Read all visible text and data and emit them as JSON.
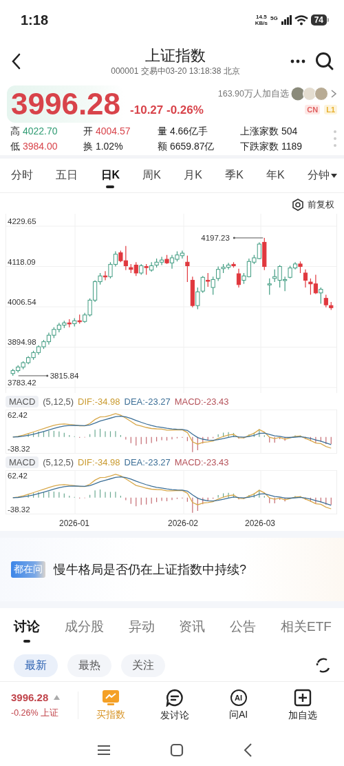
{
  "status_bar": {
    "time": "1:18",
    "net_speed": "14.5",
    "net_unit": "KB/s",
    "network": "5G",
    "battery": "74"
  },
  "header": {
    "title": "上证指数",
    "subtitle": "000001 交易中03-20 13:18:38 北京"
  },
  "quote": {
    "price": "3996.28",
    "change": "-10.27",
    "change_pct": "-0.26%",
    "followers": "163.90万人加自选",
    "badges": [
      "CN",
      "L1"
    ],
    "stats": [
      {
        "label": "高",
        "value": "4022.70",
        "color": "#2e9b72"
      },
      {
        "label": "开",
        "value": "4004.57",
        "color": "#d8434a"
      },
      {
        "label": "量",
        "value": "4.66亿手",
        "color": "#222222"
      },
      {
        "label": "上涨家数",
        "value": "504",
        "color": "#222222"
      },
      {
        "label": "低",
        "value": "3984.00",
        "color": "#d8434a"
      },
      {
        "label": "换",
        "value": "1.02%",
        "color": "#222222"
      },
      {
        "label": "额",
        "value": "6659.87亿",
        "color": "#222222"
      },
      {
        "label": "下跌家数",
        "value": "1189",
        "color": "#222222"
      }
    ]
  },
  "period_tabs": [
    {
      "label": "分时",
      "selected": false,
      "has_menu": false
    },
    {
      "label": "五日",
      "selected": false,
      "has_menu": false
    },
    {
      "label": "日K",
      "selected": true,
      "has_menu": false
    },
    {
      "label": "周K",
      "selected": false,
      "has_menu": false
    },
    {
      "label": "月K",
      "selected": false,
      "has_menu": false
    },
    {
      "label": "季K",
      "selected": false,
      "has_menu": false
    },
    {
      "label": "年K",
      "selected": false,
      "has_menu": false
    },
    {
      "label": "分钟",
      "selected": false,
      "has_menu": true
    }
  ],
  "adjust_button": "前复权",
  "kline": {
    "chart_data": {
      "type": "candlestick",
      "ylim": [
        3783.42,
        4229.65
      ],
      "yticks": [
        4229.65,
        4118.09,
        4006.54,
        3894.98,
        3783.42
      ],
      "ohlc": [
        [
          3822,
          3835,
          3815.84,
          3830
        ],
        [
          3830,
          3845,
          3825,
          3840
        ],
        [
          3840,
          3856,
          3834,
          3852
        ],
        [
          3852,
          3870,
          3848,
          3866
        ],
        [
          3866,
          3885,
          3860,
          3880
        ],
        [
          3880,
          3900,
          3874,
          3896
        ],
        [
          3896,
          3915,
          3890,
          3910
        ],
        [
          3910,
          3935,
          3902,
          3928
        ],
        [
          3928,
          3950,
          3920,
          3944
        ],
        [
          3944,
          3962,
          3936,
          3956
        ],
        [
          3956,
          3968,
          3948,
          3962
        ],
        [
          3962,
          3972,
          3950,
          3960
        ],
        [
          3960,
          3975,
          3952,
          3968
        ],
        [
          3968,
          3985,
          3960,
          3966
        ],
        [
          3966,
          3990,
          3962,
          3984
        ],
        [
          3984,
          4030,
          3980,
          4025
        ],
        [
          4025,
          4080,
          4020,
          4076
        ],
        [
          4076,
          4100,
          4068,
          4092
        ],
        [
          4092,
          4105,
          4080,
          4090
        ],
        [
          4090,
          4130,
          4085,
          4124
        ],
        [
          4124,
          4160,
          4118,
          4152
        ],
        [
          4156,
          4162,
          4130,
          4134
        ],
        [
          4134,
          4175,
          4108,
          4120
        ],
        [
          4115,
          4125,
          4100,
          4110
        ],
        [
          4122,
          4130,
          4092,
          4100
        ],
        [
          4100,
          4125,
          4095,
          4120
        ],
        [
          4118,
          4125,
          4095,
          4115
        ],
        [
          4108,
          4130,
          4104,
          4120
        ],
        [
          4122,
          4140,
          4115,
          4130
        ],
        [
          4130,
          4145,
          4122,
          4136
        ],
        [
          4138,
          4150,
          4125,
          4128
        ],
        [
          4128,
          4150,
          4112,
          4142
        ],
        [
          4138,
          4160,
          4132,
          4150
        ],
        [
          4148,
          4162,
          4140,
          4155
        ],
        [
          4130,
          4148,
          4075,
          4120
        ],
        [
          4080,
          4090,
          4005,
          4010
        ],
        [
          4010,
          4060,
          4000,
          4048
        ],
        [
          4050,
          4092,
          4045,
          4088
        ],
        [
          4080,
          4100,
          4062,
          4078
        ],
        [
          4060,
          4090,
          4040,
          4082
        ],
        [
          4085,
          4118,
          4078,
          4110
        ],
        [
          4112,
          4125,
          4100,
          4116
        ],
        [
          4116,
          4128,
          4110,
          4122
        ],
        [
          4124,
          4130,
          4115,
          4120
        ],
        [
          4098,
          4112,
          4060,
          4068
        ],
        [
          4080,
          4100,
          4070,
          4092
        ],
        [
          4090,
          4140,
          4088,
          4132
        ],
        [
          4130,
          4150,
          4125,
          4142
        ],
        [
          4140,
          4185,
          4138,
          4180
        ],
        [
          4185,
          4197.23,
          4108,
          4118
        ],
        [
          4068,
          4085,
          4040,
          4070
        ],
        [
          4085,
          4110,
          4075,
          4090
        ],
        [
          4080,
          4122,
          4060,
          4118
        ],
        [
          4080,
          4090,
          4050,
          4082
        ],
        [
          4088,
          4120,
          4085,
          4114
        ],
        [
          4114,
          4130,
          4110,
          4125
        ],
        [
          4125,
          4132,
          4100,
          4118
        ],
        [
          4100,
          4110,
          4060,
          4080
        ],
        [
          4075,
          4085,
          4040,
          4070
        ],
        [
          4070,
          4095,
          4042,
          4045
        ],
        [
          4045,
          4060,
          4015,
          4055
        ],
        [
          4030,
          4040,
          4005,
          4012
        ],
        [
          4010,
          4020,
          3998,
          4004
        ]
      ],
      "annotations": [
        "4197.23",
        "3815.84"
      ],
      "grid": true
    }
  },
  "macd_panels": [
    {
      "tag": "MACD",
      "params": "(5,12,5)",
      "dif": "DIF:-34.98",
      "dea": "DEA:-23.27",
      "macd": "MACD:-23.43",
      "y_max": "62.42",
      "y_min": "-38.32"
    },
    {
      "tag": "MACD",
      "params": "(5,12,5)",
      "dif": "DIF:-34.98",
      "dea": "DEA:-23.27",
      "macd": "MACD:-23.43",
      "y_max": "62.42",
      "y_min": "-38.32"
    }
  ],
  "x_labels": [
    "2026-01",
    "2026-02",
    "2026-03"
  ],
  "question": {
    "tag": "都在问",
    "text": "慢牛格局是否仍在上证指数中持续?"
  },
  "content_tabs": [
    {
      "label": "讨论",
      "selected": true
    },
    {
      "label": "成分股",
      "selected": false
    },
    {
      "label": "异动",
      "selected": false
    },
    {
      "label": "资讯",
      "selected": false
    },
    {
      "label": "公告",
      "selected": false
    },
    {
      "label": "相关ETF",
      "selected": false
    }
  ],
  "sub_tabs": [
    {
      "label": "最新",
      "selected": true
    },
    {
      "label": "最热",
      "selected": false
    },
    {
      "label": "关注",
      "selected": false
    }
  ],
  "bottom_bar": {
    "price": "3996.28",
    "change": "-0.26%",
    "name": "上证",
    "actions": [
      {
        "kind": "buy",
        "label": "买指数",
        "highlighted": true
      },
      {
        "kind": "discuss",
        "label": "发讨论",
        "highlighted": false
      },
      {
        "kind": "ai",
        "label": "问AI",
        "icon_text": "AI",
        "highlighted": false
      },
      {
        "kind": "watch",
        "label": "加自选",
        "highlighted": false
      }
    ]
  }
}
